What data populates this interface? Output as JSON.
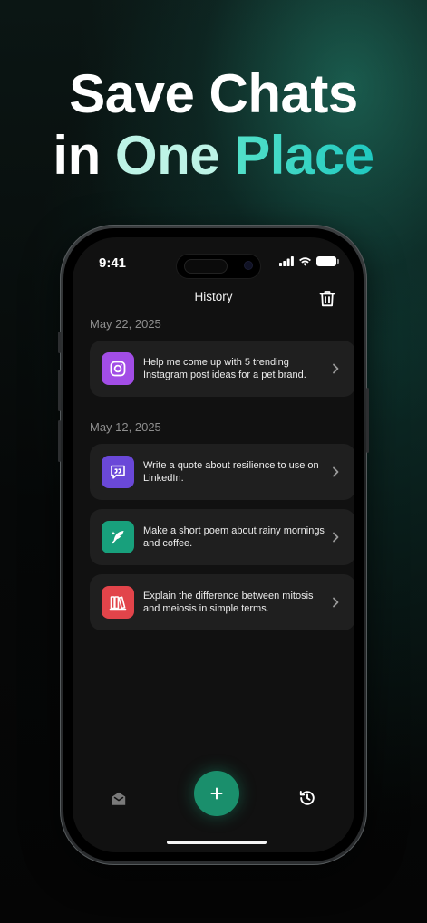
{
  "headline": {
    "line1": "Save Chats",
    "word_in": "in",
    "word_one": "One",
    "word_place": "Place"
  },
  "status_bar": {
    "time": "9:41"
  },
  "header": {
    "title": "History"
  },
  "groups": [
    {
      "date": "May 22, 2025",
      "items": [
        {
          "text": "Help me come up with 5 trending Instagram post ideas for a pet brand.",
          "icon": "instagram-icon",
          "color": "#a24de6"
        }
      ]
    },
    {
      "date": "May 12, 2025",
      "items": [
        {
          "text": "Write a quote about resilience to use on LinkedIn.",
          "icon": "quote-icon",
          "color": "#6a48d8"
        },
        {
          "text": "Make a short poem about rainy mornings and coffee.",
          "icon": "quill-icon",
          "color": "#18a07c"
        },
        {
          "text": "Explain the difference between mitosis and meiosis in simple terms.",
          "icon": "books-icon",
          "color": "#e2444a"
        }
      ]
    }
  ],
  "colors": {
    "accent": "#1a8f6c",
    "headline_place": "#22d3c0",
    "headline_one": "#bdf3e6",
    "card_bg": "#1f1f1f"
  }
}
